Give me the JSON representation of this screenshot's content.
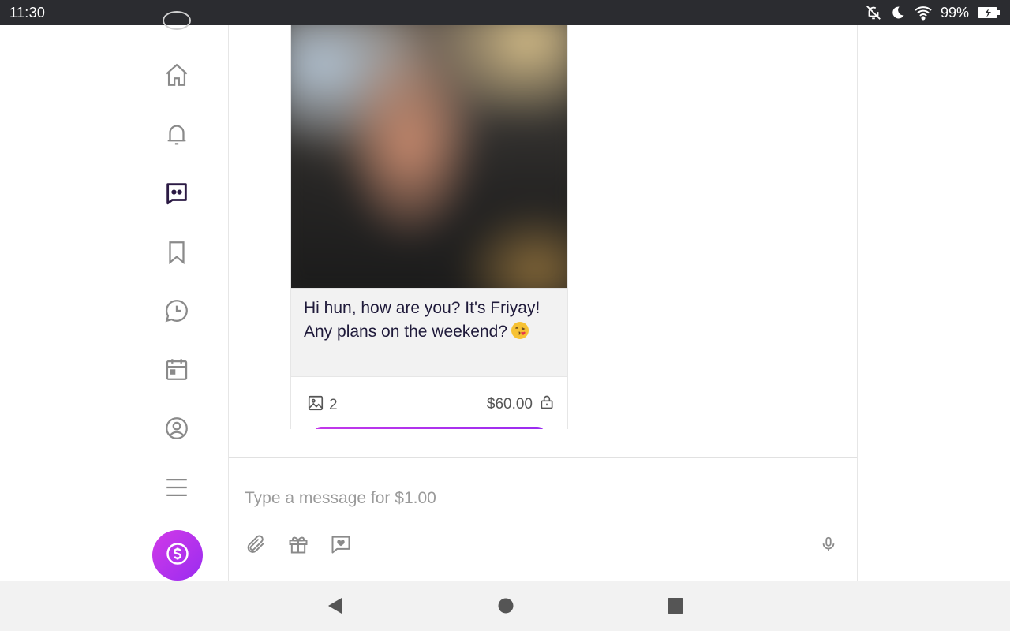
{
  "status_bar": {
    "time": "11:30",
    "battery": "99%",
    "icons": [
      "notifications-off-icon",
      "moon-icon",
      "wifi-icon",
      "battery-charging-icon"
    ]
  },
  "sidebar": {
    "items": [
      {
        "name": "home-icon"
      },
      {
        "name": "bell-icon"
      },
      {
        "name": "messages-icon",
        "active": true
      },
      {
        "name": "bookmark-icon"
      },
      {
        "name": "clock-chat-icon"
      },
      {
        "name": "calendar-icon"
      },
      {
        "name": "profile-icon"
      },
      {
        "name": "menu-icon"
      }
    ],
    "tip_button_icon": "dollar-icon",
    "active_color": "#2b1a44",
    "icon_color": "#8a8a8a"
  },
  "message": {
    "text": "Hi hun, how are you? It's Friyay! Any plans on the weekend?",
    "emoji": "kissing-face-emoji",
    "media_count": "2",
    "price": "$60.00",
    "lock_icon": "lock-icon"
  },
  "composer": {
    "placeholder": "Type a message for $1.00",
    "icons": [
      "paperclip-icon",
      "gift-icon",
      "heart-message-icon",
      "microphone-icon"
    ]
  },
  "colors": {
    "accent_start": "#d13ae8",
    "accent_end": "#9a2cf0",
    "text_dark": "#1f1a3a"
  },
  "android_nav": {
    "buttons": [
      "back-button",
      "home-button",
      "recents-button"
    ]
  }
}
